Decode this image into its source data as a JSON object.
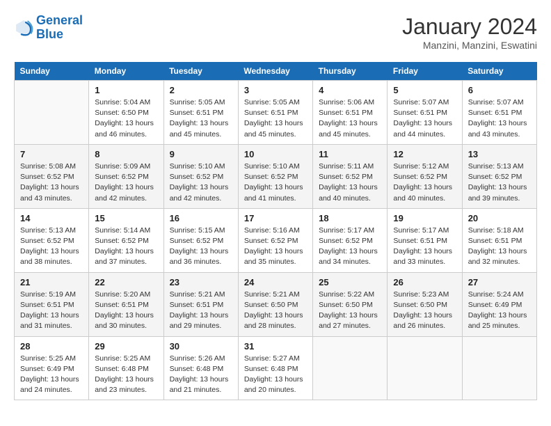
{
  "header": {
    "logo_line1": "General",
    "logo_line2": "Blue",
    "month": "January 2024",
    "location": "Manzini, Manzini, Eswatini"
  },
  "days_of_week": [
    "Sunday",
    "Monday",
    "Tuesday",
    "Wednesday",
    "Thursday",
    "Friday",
    "Saturday"
  ],
  "weeks": [
    [
      {
        "day": "",
        "text": ""
      },
      {
        "day": "1",
        "text": "Sunrise: 5:04 AM\nSunset: 6:50 PM\nDaylight: 13 hours\nand 46 minutes."
      },
      {
        "day": "2",
        "text": "Sunrise: 5:05 AM\nSunset: 6:51 PM\nDaylight: 13 hours\nand 45 minutes."
      },
      {
        "day": "3",
        "text": "Sunrise: 5:05 AM\nSunset: 6:51 PM\nDaylight: 13 hours\nand 45 minutes."
      },
      {
        "day": "4",
        "text": "Sunrise: 5:06 AM\nSunset: 6:51 PM\nDaylight: 13 hours\nand 45 minutes."
      },
      {
        "day": "5",
        "text": "Sunrise: 5:07 AM\nSunset: 6:51 PM\nDaylight: 13 hours\nand 44 minutes."
      },
      {
        "day": "6",
        "text": "Sunrise: 5:07 AM\nSunset: 6:51 PM\nDaylight: 13 hours\nand 43 minutes."
      }
    ],
    [
      {
        "day": "7",
        "text": "Sunrise: 5:08 AM\nSunset: 6:52 PM\nDaylight: 13 hours\nand 43 minutes."
      },
      {
        "day": "8",
        "text": "Sunrise: 5:09 AM\nSunset: 6:52 PM\nDaylight: 13 hours\nand 42 minutes."
      },
      {
        "day": "9",
        "text": "Sunrise: 5:10 AM\nSunset: 6:52 PM\nDaylight: 13 hours\nand 42 minutes."
      },
      {
        "day": "10",
        "text": "Sunrise: 5:10 AM\nSunset: 6:52 PM\nDaylight: 13 hours\nand 41 minutes."
      },
      {
        "day": "11",
        "text": "Sunrise: 5:11 AM\nSunset: 6:52 PM\nDaylight: 13 hours\nand 40 minutes."
      },
      {
        "day": "12",
        "text": "Sunrise: 5:12 AM\nSunset: 6:52 PM\nDaylight: 13 hours\nand 40 minutes."
      },
      {
        "day": "13",
        "text": "Sunrise: 5:13 AM\nSunset: 6:52 PM\nDaylight: 13 hours\nand 39 minutes."
      }
    ],
    [
      {
        "day": "14",
        "text": "Sunrise: 5:13 AM\nSunset: 6:52 PM\nDaylight: 13 hours\nand 38 minutes."
      },
      {
        "day": "15",
        "text": "Sunrise: 5:14 AM\nSunset: 6:52 PM\nDaylight: 13 hours\nand 37 minutes."
      },
      {
        "day": "16",
        "text": "Sunrise: 5:15 AM\nSunset: 6:52 PM\nDaylight: 13 hours\nand 36 minutes."
      },
      {
        "day": "17",
        "text": "Sunrise: 5:16 AM\nSunset: 6:52 PM\nDaylight: 13 hours\nand 35 minutes."
      },
      {
        "day": "18",
        "text": "Sunrise: 5:17 AM\nSunset: 6:52 PM\nDaylight: 13 hours\nand 34 minutes."
      },
      {
        "day": "19",
        "text": "Sunrise: 5:17 AM\nSunset: 6:51 PM\nDaylight: 13 hours\nand 33 minutes."
      },
      {
        "day": "20",
        "text": "Sunrise: 5:18 AM\nSunset: 6:51 PM\nDaylight: 13 hours\nand 32 minutes."
      }
    ],
    [
      {
        "day": "21",
        "text": "Sunrise: 5:19 AM\nSunset: 6:51 PM\nDaylight: 13 hours\nand 31 minutes."
      },
      {
        "day": "22",
        "text": "Sunrise: 5:20 AM\nSunset: 6:51 PM\nDaylight: 13 hours\nand 30 minutes."
      },
      {
        "day": "23",
        "text": "Sunrise: 5:21 AM\nSunset: 6:51 PM\nDaylight: 13 hours\nand 29 minutes."
      },
      {
        "day": "24",
        "text": "Sunrise: 5:21 AM\nSunset: 6:50 PM\nDaylight: 13 hours\nand 28 minutes."
      },
      {
        "day": "25",
        "text": "Sunrise: 5:22 AM\nSunset: 6:50 PM\nDaylight: 13 hours\nand 27 minutes."
      },
      {
        "day": "26",
        "text": "Sunrise: 5:23 AM\nSunset: 6:50 PM\nDaylight: 13 hours\nand 26 minutes."
      },
      {
        "day": "27",
        "text": "Sunrise: 5:24 AM\nSunset: 6:49 PM\nDaylight: 13 hours\nand 25 minutes."
      }
    ],
    [
      {
        "day": "28",
        "text": "Sunrise: 5:25 AM\nSunset: 6:49 PM\nDaylight: 13 hours\nand 24 minutes."
      },
      {
        "day": "29",
        "text": "Sunrise: 5:25 AM\nSunset: 6:48 PM\nDaylight: 13 hours\nand 23 minutes."
      },
      {
        "day": "30",
        "text": "Sunrise: 5:26 AM\nSunset: 6:48 PM\nDaylight: 13 hours\nand 21 minutes."
      },
      {
        "day": "31",
        "text": "Sunrise: 5:27 AM\nSunset: 6:48 PM\nDaylight: 13 hours\nand 20 minutes."
      },
      {
        "day": "",
        "text": ""
      },
      {
        "day": "",
        "text": ""
      },
      {
        "day": "",
        "text": ""
      }
    ]
  ]
}
